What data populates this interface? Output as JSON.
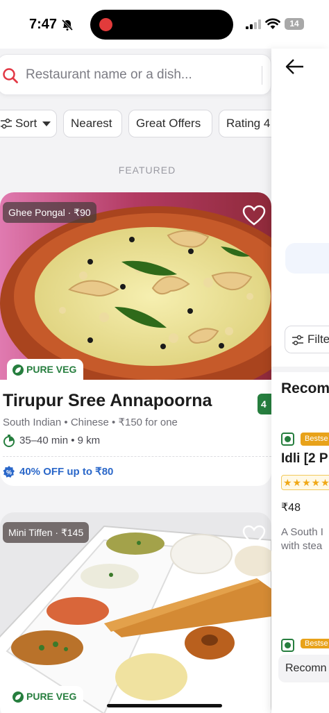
{
  "status_bar": {
    "time": "7:47",
    "battery": "14"
  },
  "search": {
    "placeholder": "Restaurant name or a dish..."
  },
  "filters": [
    {
      "label": "Sort"
    },
    {
      "label": "Nearest"
    },
    {
      "label": "Great Offers"
    },
    {
      "label": "Rating 4"
    }
  ],
  "section": {
    "label": "FEATURED"
  },
  "restaurants": [
    {
      "dish_badge": "Ghee Pongal · ₹90",
      "veg_tag": "PURE VEG",
      "name": "Tirupur Sree Annapoorna",
      "rating": "4",
      "meta": "South Indian  •  Chinese  •  ₹150 for one",
      "time_distance": "35–40 min • 9 km",
      "offer": "40% OFF up to ₹80"
    },
    {
      "dish_badge": "Mini Tiffen · ₹145",
      "veg_tag": "PURE VEG"
    }
  ],
  "right_panel": {
    "filter_label": "Filte",
    "heading": "Recom",
    "items": [
      {
        "badge": "Bestse",
        "name": "Idli [2 P",
        "price": "₹48",
        "description_line1": "A South I",
        "description_line2": "with stea"
      },
      {
        "badge": "Bestse"
      }
    ],
    "bottom_label": "Recomn"
  },
  "colors": {
    "accent_red": "#e23744",
    "veg_green": "#267e3e",
    "offer_blue": "#2a67c9",
    "bestseller": "#e8a21a"
  }
}
